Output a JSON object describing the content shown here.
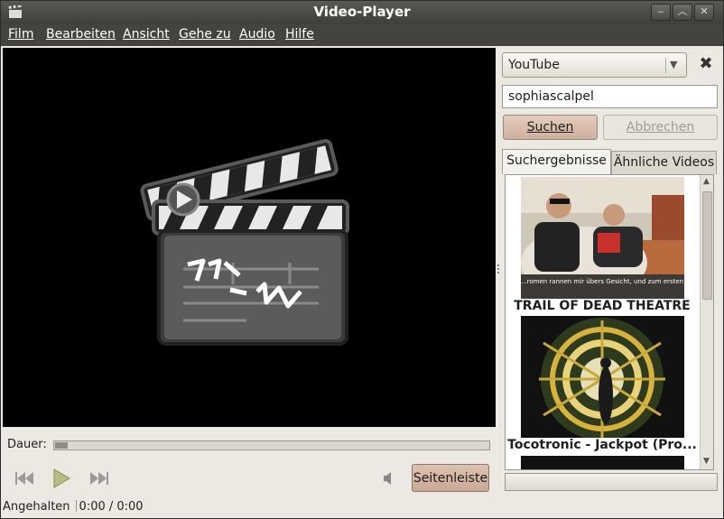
{
  "window": {
    "title": "Video-Player"
  },
  "menu": [
    "Film",
    "Bearbeiten",
    "Ansicht",
    "Gehe zu",
    "Audio",
    "Hilfe"
  ],
  "player": {
    "duration_label": "Dauer:",
    "sidebar_button": "Seitenleiste",
    "status": "Angehalten",
    "time": "0:00 / 0:00"
  },
  "sidebar": {
    "source": "YouTube",
    "search_value": "sophiascalpel",
    "search_button": "Suchen",
    "cancel_button": "Abbrechen",
    "tabs": [
      "Suchergebnisse",
      "Ähnliche Videos"
    ],
    "results": [
      {
        "title": "TRAIL OF DEAD THEATRE",
        "caption": "...romen rannen mir übers Gesicht, und zum ersten"
      },
      {
        "title": "Tocotronic - Jackpot (Pro..."
      }
    ]
  }
}
